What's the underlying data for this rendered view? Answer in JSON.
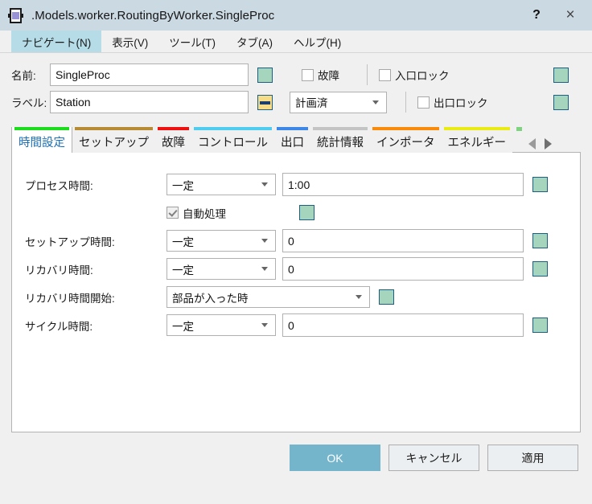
{
  "window": {
    "title": ".Models.worker.RoutingByWorker.SingleProc",
    "icon": "workstation-icon",
    "help_label": "?",
    "close_label": "×",
    "titlebar_color": "#cbd9e3"
  },
  "menubar": {
    "items": [
      {
        "label": "ナビゲート(N)",
        "active": true
      },
      {
        "label": "表示(V)",
        "active": false
      },
      {
        "label": "ツール(T)",
        "active": false
      },
      {
        "label": "タブ(A)",
        "active": false
      },
      {
        "label": "ヘルプ(H)",
        "active": false
      }
    ],
    "highlight_color": "#b6dce8"
  },
  "header": {
    "name_label": "名前:",
    "name_value": "SingleProc",
    "label_label": "ラベル:",
    "label_value": "Station",
    "failure_checkbox": {
      "label": "故障",
      "checked": false
    },
    "status_combo": {
      "value": "計画済"
    },
    "entrance_lock": {
      "label": "入口ロック",
      "checked": false
    },
    "exit_lock": {
      "label": "出口ロック",
      "checked": false
    },
    "indicator_green": "#a6d5be",
    "indicator_yellow": "#f6dc86"
  },
  "tabs": [
    {
      "label": "時間設定",
      "color": "#1ddc1d",
      "active": true
    },
    {
      "label": "セットアップ",
      "color": "#b78b33",
      "active": false
    },
    {
      "label": "故障",
      "color": "#ef1010",
      "active": false
    },
    {
      "label": "コントロール",
      "color": "#4ecdf0",
      "active": false
    },
    {
      "label": "出口",
      "color": "#3d87e8",
      "active": false
    },
    {
      "label": "統計情報",
      "color": "#c4c4c4",
      "active": false
    },
    {
      "label": "インポータ",
      "color": "#f98a0a",
      "active": false
    },
    {
      "label": "エネルギー",
      "color": "#eaea14",
      "active": false
    }
  ],
  "tab_nav": {
    "prev": "scroll-left",
    "next": "scroll-right",
    "more_dot_color": "#7ed47e"
  },
  "panel": {
    "rows": [
      {
        "label": "プロセス時間:",
        "combo": "一定",
        "value": "1:00",
        "kind": "combo-text"
      },
      {
        "label": "",
        "checkbox": {
          "label": "自動処理",
          "checked": true
        },
        "kind": "checkbox"
      },
      {
        "label": "セットアップ時間:",
        "combo": "一定",
        "value": "0",
        "kind": "combo-text"
      },
      {
        "label": "リカバリ時間:",
        "combo": "一定",
        "value": "0",
        "kind": "combo-text"
      },
      {
        "label": "リカバリ時間開始:",
        "combo": "部品が入った時",
        "kind": "combo-wide"
      },
      {
        "label": "サイクル時間:",
        "combo": "一定",
        "value": "0",
        "kind": "combo-text"
      }
    ]
  },
  "footer": {
    "ok": "OK",
    "cancel": "キャンセル",
    "apply": "適用",
    "ok_color": "#74b5cc"
  }
}
